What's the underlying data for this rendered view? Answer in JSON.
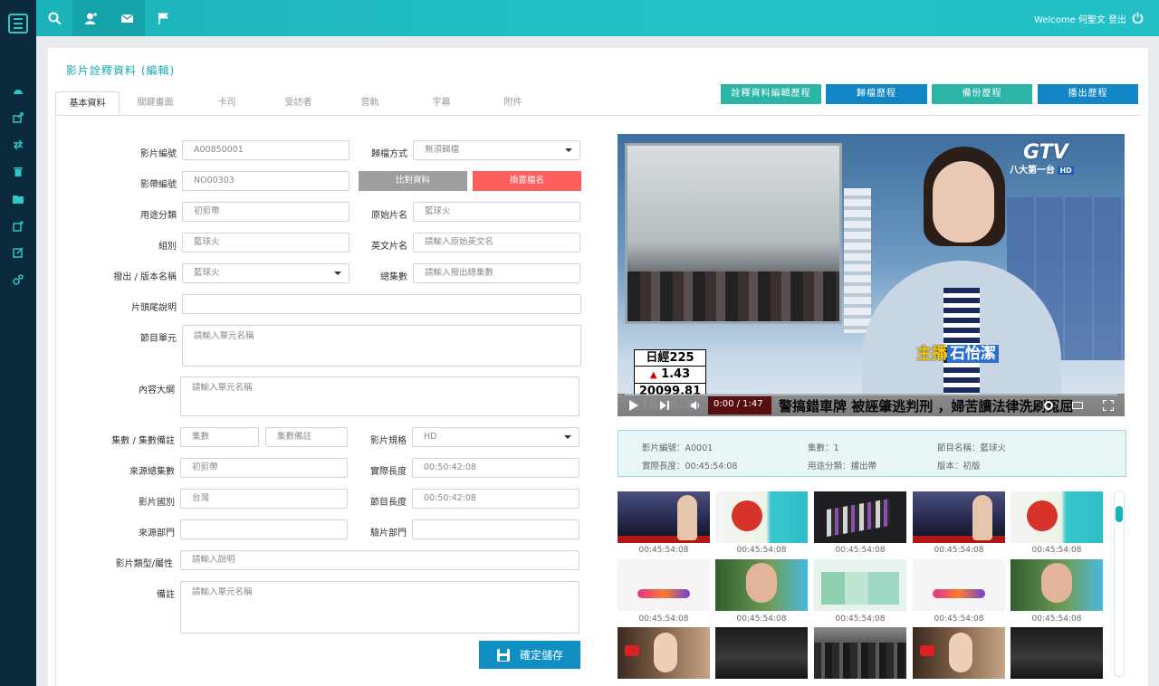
{
  "topbar": {
    "welcome": "Welcome 何聖文",
    "logout": "登出"
  },
  "page": {
    "title": "影片詮釋資料 (編輯)",
    "tabs": [
      "基本資料",
      "關鍵畫面",
      "卡司",
      "受訪者",
      "音軌",
      "字幕",
      "附件"
    ],
    "header_buttons": [
      "詮釋資料編輯歷程",
      "歸檔歷程",
      "備份歷程",
      "播出歷程"
    ]
  },
  "form": {
    "video_id": {
      "label": "影片編號",
      "value": "A00850001"
    },
    "archive_method": {
      "label": "歸檔方式",
      "value": "無須歸檔"
    },
    "tape_id": {
      "label": "影帶編號",
      "value": "NO00303"
    },
    "compare_btn": "比對資料",
    "rename_btn": "換置檔名",
    "usage_class": {
      "label": "用途分類",
      "value": "初剪帶"
    },
    "original_title": {
      "label": "原始片名",
      "value": "藍球火"
    },
    "group": {
      "label": "組別",
      "value": "藍球火"
    },
    "english_title": {
      "label": "英文片名",
      "placeholder": "請輸入原始英文名"
    },
    "version_name": {
      "label": "撥出 / 版本名稱",
      "value": "藍球火"
    },
    "total_episodes": {
      "label": "總集數",
      "placeholder": "請輸入撥出總集數"
    },
    "head_tail_note": {
      "label": "片頭尾說明",
      "value": ""
    },
    "program_unit": {
      "label": "節目單元",
      "placeholder": "請輸入單元名稱"
    },
    "synopsis": {
      "label": "內容大綱",
      "placeholder": "請輸入單元名稱"
    },
    "episode": {
      "label": "集數 / 集數備註",
      "ep_placeholder": "集數",
      "note_placeholder": "集數備註"
    },
    "video_spec": {
      "label": "影片規格",
      "value": "HD"
    },
    "source_episodes": {
      "label": "來源總集數",
      "value": "初剪帶"
    },
    "actual_length": {
      "label": "實際長度",
      "value": "00:50:42:08"
    },
    "country": {
      "label": "影片國別",
      "value": "台灣"
    },
    "program_length": {
      "label": "節目長度",
      "value": "00:50:42:08"
    },
    "source_dept": {
      "label": "來源部門",
      "value": ""
    },
    "check_dept": {
      "label": "驗片部門",
      "value": ""
    },
    "video_type": {
      "label": "影片類型/屬性",
      "placeholder": "請輸入說明"
    },
    "remarks": {
      "label": "備註",
      "placeholder": "請輸入單元名稱"
    },
    "save_label": "確定儲存"
  },
  "video": {
    "channel_logo": "GTV",
    "channel_sub": "八大第一台",
    "channel_sub_badge": "HD",
    "ticker_rows": [
      "日經225",
      "1.43",
      "20099.81"
    ],
    "ticker_time": "18:48:36",
    "headline": "警搞錯車牌 被誣肇逃判刑 ，婦苦讀法律洗刷冤屈",
    "anchor_prefix": "主播",
    "anchor_name": "石怡潔",
    "time": "0:00 / 1:47"
  },
  "info": {
    "video_id": "影片編號：A0001",
    "episode": "集數：1",
    "program_unit": "節目名稱：藍球火",
    "actual_length": "實際長度：00:45:54:08",
    "usage": "用途分類：播出帶",
    "version": "版本：初版"
  },
  "thumbnails": {
    "row1": [
      "00:45:54:08",
      "00:45:54:08",
      "00:45:54:08",
      "00:45:54:08",
      "00:45:54:08"
    ],
    "row2": [
      "00:45:54:08",
      "00:45:54:08",
      "00:45:54:08",
      "00:45:54:08",
      "00:45:54:08"
    ]
  },
  "colors": {
    "accent": "#1bb3b9",
    "primary_button": "#0f8fc4",
    "danger_button": "#ff5e5e",
    "rail": "#0a2a3c"
  }
}
